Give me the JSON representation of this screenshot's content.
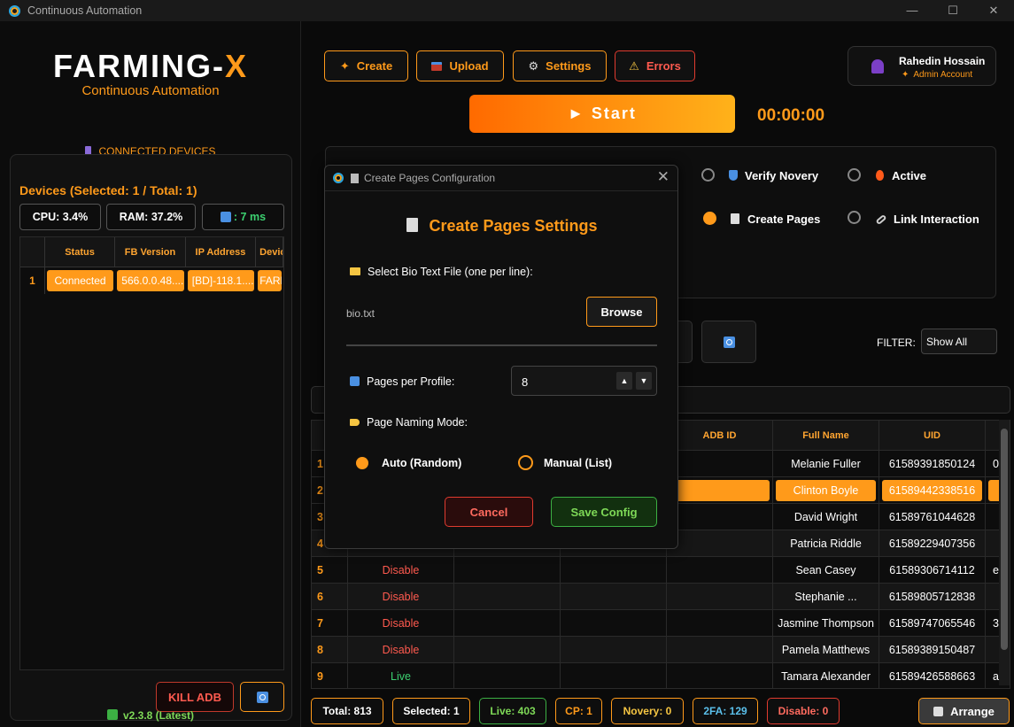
{
  "window": {
    "title": "Continuous Automation"
  },
  "brand": {
    "name_main": "FARMING-",
    "name_x": "X",
    "subtitle": "Continuous Automation"
  },
  "left": {
    "connected_title": "CONNECTED DEVICES",
    "devices_summary": "Devices (Selected: 1 / Total: 1)",
    "cpu": "CPU: 3.4%",
    "ram": "RAM: 37.2%",
    "ping": ": 7 ms",
    "device_table": {
      "headers": [
        "Status",
        "FB Version",
        "IP Address",
        "Devic"
      ],
      "rows": [
        [
          "1",
          "Connected",
          "566.0.0.48....",
          "[BD]-118.1....",
          "FARM"
        ]
      ]
    },
    "kill_adb": "KILL ADB",
    "version": "v2.3.8 (Latest)"
  },
  "toolbar": {
    "create": "Create",
    "upload": "Upload",
    "settings": "Settings",
    "errors": "Errors"
  },
  "profile": {
    "name": "Rahedin Hossain",
    "role": "Admin Account"
  },
  "start": {
    "label": "► Start",
    "timer": "00:00:00"
  },
  "options": {
    "verify_novery": "Verify Novery",
    "active": "Active",
    "create_pages": "Create Pages",
    "link_interaction": "Link Interaction"
  },
  "filter": {
    "label": "FILTER:",
    "value": "Show All"
  },
  "main_table": {
    "headers": {
      "adb_id": "ADB ID",
      "full_name": "Full Name",
      "uid": "UID"
    },
    "rows": [
      {
        "n": "1",
        "status": "",
        "name": "Melanie Fuller",
        "uid": "61589391850124",
        "extra": "0"
      },
      {
        "n": "2",
        "status": "",
        "name": "Clinton Boyle",
        "uid": "61589442338516",
        "extra": ""
      },
      {
        "n": "3",
        "status": "",
        "name": "David Wright",
        "uid": "61589761044628",
        "extra": ""
      },
      {
        "n": "4",
        "status": "",
        "name": "Patricia Riddle",
        "uid": "61589229407356",
        "extra": ""
      },
      {
        "n": "5",
        "status": "Disable",
        "name": "Sean Casey",
        "uid": "61589306714112",
        "extra": "e"
      },
      {
        "n": "6",
        "status": "Disable",
        "name": "Stephanie ...",
        "uid": "61589805712838",
        "extra": ""
      },
      {
        "n": "7",
        "status": "Disable",
        "name": "Jasmine Thompson",
        "uid": "61589747065546",
        "extra": "3"
      },
      {
        "n": "8",
        "status": "Disable",
        "name": "Pamela Matthews",
        "uid": "61589389150487",
        "extra": ""
      },
      {
        "n": "9",
        "status": "Live",
        "name": "Tamara Alexander",
        "uid": "61589426588663",
        "extra": "a"
      }
    ]
  },
  "footer": {
    "total": "Total: 813",
    "selected": "Selected: 1",
    "live": "Live: 403",
    "cp": "CP: 1",
    "novery": "Novery: 0",
    "twofa": "2FA: 129",
    "disable": "Disable: 0",
    "arrange": "Arrange"
  },
  "dialog": {
    "title": "Create Pages Configuration",
    "heading": "Create Pages Settings",
    "bio_label": "Select Bio Text File (one per line):",
    "file_name": "bio.txt",
    "browse": "Browse",
    "pages_label": "Pages per Profile:",
    "pages_value": "8",
    "naming_label": "Page Naming Mode:",
    "mode_auto": "Auto (Random)",
    "mode_manual": "Manual (List)",
    "cancel": "Cancel",
    "save": "Save Config"
  },
  "colors": {
    "accent": "#ff9a1a",
    "danger": "#e03b2f",
    "success": "#3cb043"
  }
}
